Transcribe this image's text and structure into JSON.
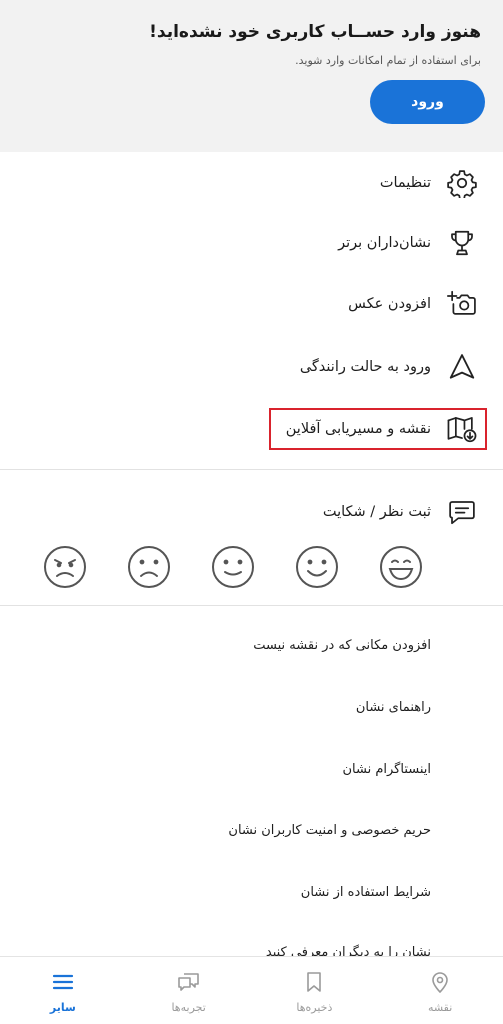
{
  "login_banner": {
    "title": "هنوز وارد حســاب کاربری خود نشده‌اید!",
    "subtitle": "برای استفاده از تمام امکانات وارد شوید.",
    "login_button": "ورود"
  },
  "menu": {
    "items": [
      {
        "label": "تنظیمات",
        "icon": "gear-icon"
      },
      {
        "label": "نشان‌داران برتر",
        "icon": "trophy-icon"
      },
      {
        "label": "افزودن عکس",
        "icon": "add-photo-icon"
      },
      {
        "label": "ورود به حالت رانندگی",
        "icon": "navigation-arrow-icon"
      },
      {
        "label": "نقشه و مسیریابی آفلاین",
        "icon": "offline-map-icon"
      }
    ]
  },
  "feedback": {
    "label": "ثبت نظر / شکایت",
    "icon": "feedback-icon",
    "faces": [
      "very-happy-face-icon",
      "happy-face-icon",
      "neutral-face-icon",
      "sad-face-icon",
      "angry-face-icon"
    ]
  },
  "links": [
    "افزودن مکانی که در نقشه نیست",
    "راهنمای نشان",
    "اینستاگرام نشان",
    "حریم خصوصی و امنیت کاربران نشان",
    "شرایط استفاده از نشان",
    "نشان را به دیگران معرفی کنید"
  ],
  "bottom_nav": {
    "items": [
      {
        "label": "نقشه",
        "icon": "map-pin-icon",
        "active": false
      },
      {
        "label": "ذخیره‌ها",
        "icon": "bookmark-icon",
        "active": false
      },
      {
        "label": "تجربه‌ها",
        "icon": "chat-icon",
        "active": false
      },
      {
        "label": "سایر",
        "icon": "menu-icon",
        "active": true
      }
    ]
  },
  "colors": {
    "accent": "#1a73d8",
    "highlight_border": "#d9232d",
    "banner_bg": "#f2f2f2"
  }
}
